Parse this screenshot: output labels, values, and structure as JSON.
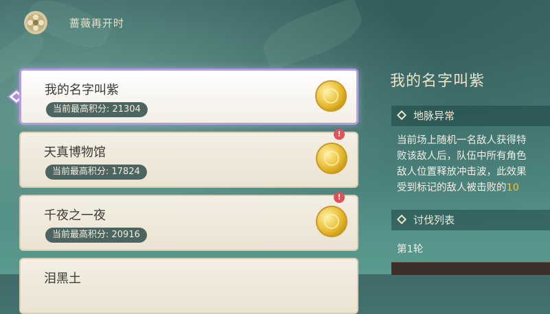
{
  "header": {
    "title": "蔷薇再开时",
    "logo_icon": "rose-emblem-icon"
  },
  "list": {
    "items": [
      {
        "name": "我的名字叫紫",
        "score_label": "当前最高积分: 21304",
        "selected": true,
        "alert": false
      },
      {
        "name": "天真博物馆",
        "score_label": "当前最高积分: 17824",
        "selected": false,
        "alert": true
      },
      {
        "name": "千夜之一夜",
        "score_label": "当前最高积分: 20916",
        "selected": false,
        "alert": true
      },
      {
        "name": "泪黑土",
        "score_label": "",
        "selected": false,
        "alert": false
      }
    ],
    "alert_glyph": "!"
  },
  "detail": {
    "title": "我的名字叫紫",
    "section1": "地脉异常",
    "desc_lines": [
      "当前场上随机一名敌人获得特",
      "败该敌人后，队伍中所有角色",
      "敌人位置释放冲击波，此效果",
      "受到标记的敌人被击败的"
    ],
    "desc_highlight": "10",
    "section2": "讨伐列表",
    "round": "第1轮"
  },
  "colors": {
    "accent_purple": "#b59ee0",
    "highlight_gold": "#f0c43b",
    "badge_bg": "#4d6560"
  }
}
